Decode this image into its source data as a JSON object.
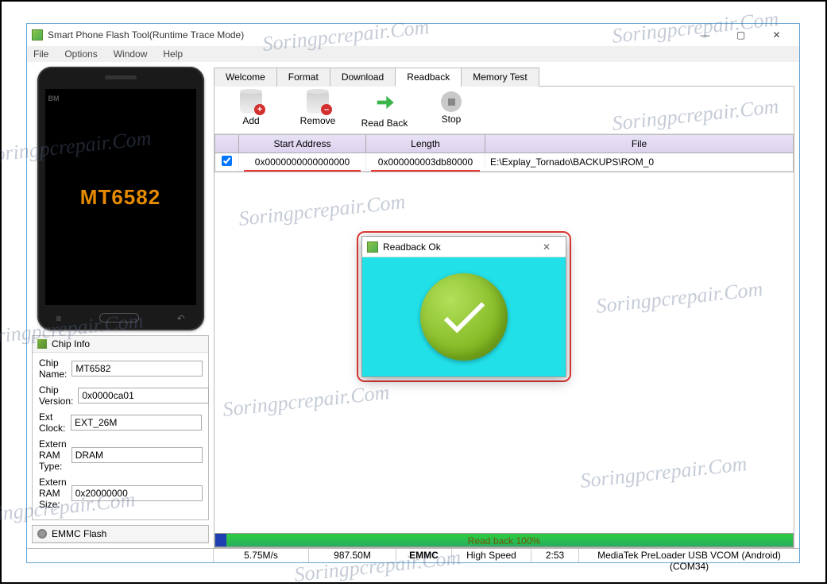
{
  "window": {
    "title": "Smart Phone Flash Tool(Runtime Trace Mode)"
  },
  "menubar": [
    "File",
    "Options",
    "Window",
    "Help"
  ],
  "phone": {
    "screen_text": "MT6582",
    "brand": "BM"
  },
  "chip_panel": {
    "title": "Chip Info",
    "rows": {
      "chip_name": {
        "label": "Chip Name:",
        "value": "MT6582"
      },
      "chip_version": {
        "label": "Chip Version:",
        "value": "0x0000ca01"
      },
      "ext_clock": {
        "label": "Ext Clock:",
        "value": "EXT_26M"
      },
      "ram_type": {
        "label": "Extern RAM Type:",
        "value": "DRAM"
      },
      "ram_size": {
        "label": "Extern RAM Size:",
        "value": "0x20000000"
      }
    }
  },
  "emmc_panel": {
    "title": "EMMC Flash"
  },
  "tabs": {
    "items": [
      "Welcome",
      "Format",
      "Download",
      "Readback",
      "Memory Test"
    ],
    "active": "Readback"
  },
  "toolbar": {
    "add": "Add",
    "remove": "Remove",
    "readback": "Read Back",
    "stop": "Stop"
  },
  "grid": {
    "headers": {
      "start": "Start Address",
      "length": "Length",
      "file": "File"
    },
    "row": {
      "checked": true,
      "start": "0x0000000000000000",
      "length": "0x000000003db80000",
      "file": "E:\\Explay_Tornado\\BACKUPS\\ROM_0"
    }
  },
  "progress": {
    "text": "Read back 100%"
  },
  "statusbar": {
    "speed": "5.75M/s",
    "size": "987.50M",
    "storage": "EMMC",
    "mode": "High Speed",
    "time": "2:53",
    "device": "MediaTek PreLoader USB VCOM (Android) (COM34)"
  },
  "dialog": {
    "title": "Readback Ok"
  },
  "watermark": "Soringpcrepair.Com"
}
